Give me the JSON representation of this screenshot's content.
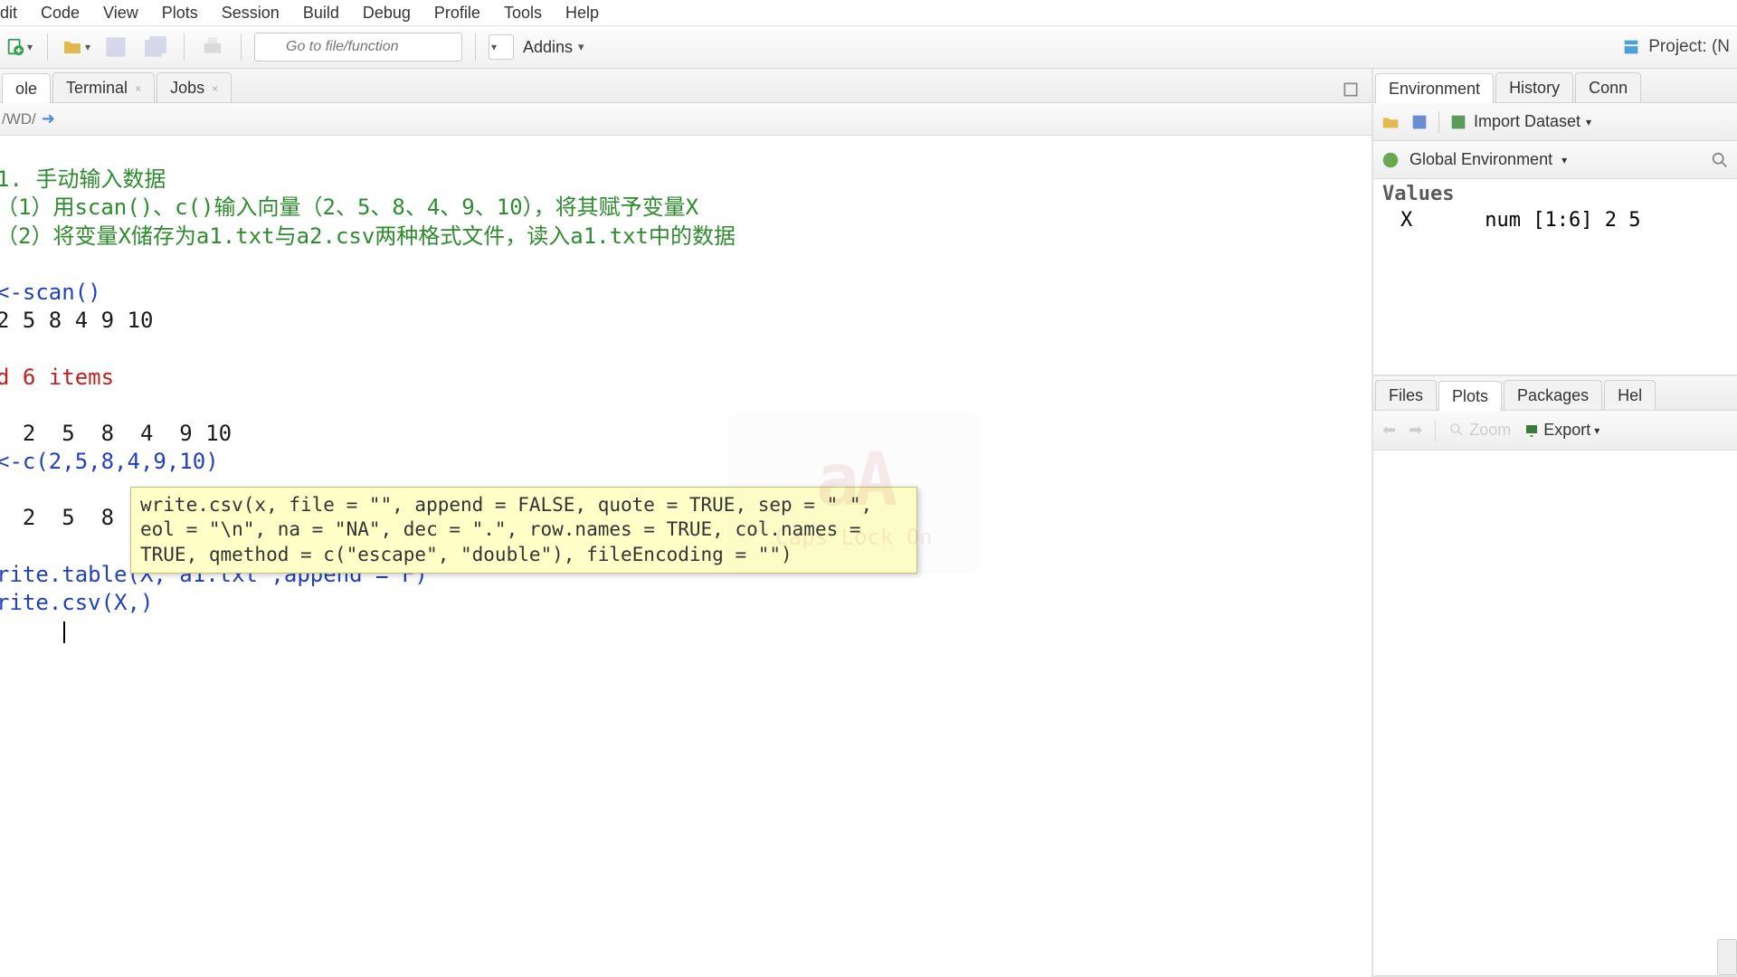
{
  "menu": {
    "items": [
      "dit",
      "Code",
      "View",
      "Plots",
      "Session",
      "Build",
      "Debug",
      "Profile",
      "Tools",
      "Help"
    ]
  },
  "toolbar": {
    "goto_placeholder": "Go to file/function",
    "addins_label": "Addins",
    "project_label": "Project: (N"
  },
  "console_tabs": {
    "items": [
      "ole",
      "Terminal",
      "Jobs"
    ],
    "active": 0
  },
  "console_path": "/WD/",
  "console": {
    "line1_green": "1. 手动输入数据",
    "line2_green_a": "（1）用scan()、c()输入向量（",
    "line2_green_b": "2、5、8、4、9、10",
    "line2_green_c": "），将其赋予变量X",
    "line3_green": "（2）将变量X储存为a1.txt与a2.csv两种格式文件，读入a1.txt中的数据",
    "line4": "<-scan()",
    "line5": "2 5 8 4 9 10",
    "line6_red": "d 6 items",
    "line7": "  2  5  8  4  9 10",
    "line8": "<-c(2,5,8,4,9,10)",
    "line9": "  2  5  8",
    "line10_blue": "rite.table(X,\"a1.txt\",append = F)",
    "line11_blue": "rite.csv(X,)"
  },
  "tooltip": "write.csv(x, file = \"\", append = FALSE, quote = TRUE, sep = \" \", eol = \"\\n\", na = \"NA\", dec = \".\", row.names = TRUE, col.names = TRUE, qmethod = c(\"escape\", \"double\"), fileEncoding = \"\")",
  "capslock": {
    "glyph": "aA",
    "label": "Caps Lock On"
  },
  "env_tabs": {
    "items": [
      "Environment",
      "History",
      "Conn"
    ],
    "active": 0
  },
  "env_toolbar": {
    "import": "Import Dataset",
    "scope": "Global Environment"
  },
  "env": {
    "header": "Values",
    "var_name": "X",
    "var_value": "num [1:6] 2 5"
  },
  "plot_tabs": {
    "items": [
      "Files",
      "Plots",
      "Packages",
      "Hel"
    ],
    "active": 1
  },
  "plot_toolbar": {
    "zoom": "Zoom",
    "export": "Export"
  }
}
